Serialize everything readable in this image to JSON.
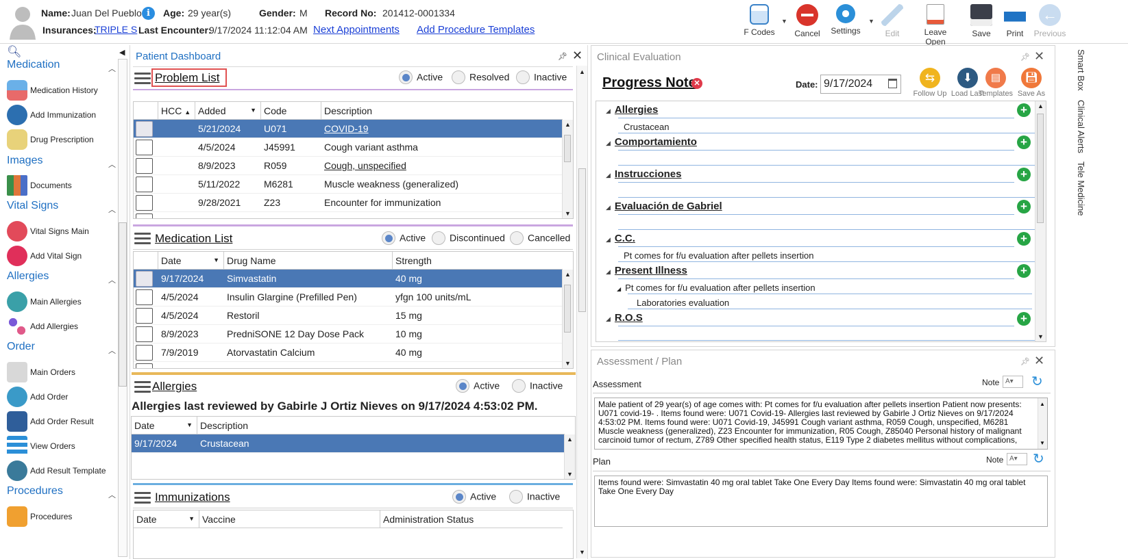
{
  "header": {
    "name_label": "Name:",
    "name_value": "Juan Del Pueblo",
    "age_label": "Age:",
    "age_value": "29 year(s)",
    "gender_label": "Gender:",
    "gender_value": "M",
    "record_label": "Record No:",
    "record_value": "201412-0001334",
    "insurances_label": "Insurances:",
    "insurance_link": "TRIPLE S",
    "last_encounter_label": "Last Encounter:",
    "last_encounter_value": "9/17/2024 11:12:04 AM",
    "next_appointments": "Next Appointments",
    "add_procedure_templates": "Add Procedure Templates"
  },
  "toolbar": {
    "fcodes": "F Codes",
    "cancel": "Cancel",
    "settings": "Settings",
    "edit": "Edit",
    "leave_open": "Leave Open",
    "save": "Save",
    "print": "Print",
    "previous": "Previous"
  },
  "sidebar": {
    "medication": "Medication",
    "medication_history": "Medication History",
    "add_immunization": "Add Immunization",
    "drug_prescription": "Drug Prescription",
    "images": "Images",
    "documents": "Documents",
    "vital_signs": "Vital Signs",
    "vital_signs_main": "Vital Signs Main",
    "add_vital_sign": "Add Vital Sign",
    "allergies": "Allergies",
    "main_allergies": "Main Allergies",
    "add_allergies": "Add Allergies",
    "order": "Order",
    "main_orders": "Main Orders",
    "add_order": "Add Order",
    "add_order_result": "Add Order Result",
    "view_orders": "View Orders",
    "add_result_template": "Add Result Template",
    "procedures": "Procedures",
    "procedures_item": "Procedures"
  },
  "dashboard": {
    "title": "Patient Dashboard",
    "problem_list": {
      "title": "Problem List",
      "filters": [
        "Active",
        "Resolved",
        "Inactive"
      ],
      "headers": [
        "HCC",
        "Added",
        "Code",
        "Description"
      ],
      "rows": [
        {
          "added": "5/21/2024",
          "code": "U071",
          "desc": "COVID-19"
        },
        {
          "added": "4/5/2024",
          "code": "J45991",
          "desc": "Cough variant asthma"
        },
        {
          "added": "8/9/2023",
          "code": "R059",
          "desc": "Cough, unspecified"
        },
        {
          "added": "5/11/2022",
          "code": "M6281",
          "desc": "Muscle weakness (generalized)"
        },
        {
          "added": "9/28/2021",
          "code": "Z23",
          "desc": "Encounter for immunization"
        }
      ]
    },
    "medication_list": {
      "title": "Medication List",
      "filters": [
        "Active",
        "Discontinued",
        "Cancelled"
      ],
      "headers": [
        "Date",
        "Drug Name",
        "Strength"
      ],
      "rows": [
        {
          "date": "9/17/2024",
          "drug": "Simvastatin",
          "strength": "40 mg"
        },
        {
          "date": "4/5/2024",
          "drug": "Insulin Glargine (Prefilled Pen)",
          "strength": "yfgn 100 units/mL"
        },
        {
          "date": "4/5/2024",
          "drug": "Restoril",
          "strength": "15 mg"
        },
        {
          "date": "8/9/2023",
          "drug": "PredniSONE 12 Day Dose Pack",
          "strength": "10 mg"
        },
        {
          "date": "7/9/2019",
          "drug": "Atorvastatin Calcium",
          "strength": "40 mg"
        }
      ]
    },
    "allergies": {
      "title": "Allergies",
      "filters": [
        "Active",
        "Inactive"
      ],
      "reviewed": "Allergies last reviewed by Gabirle J Ortiz Nieves on 9/17/2024 4:53:02 PM.",
      "headers": [
        "Date",
        "Description"
      ],
      "rows": [
        {
          "date": "9/17/2024",
          "desc": "Crustacean"
        }
      ]
    },
    "immunizations": {
      "title": "Immunizations",
      "filters": [
        "Active",
        "Inactive"
      ],
      "headers": [
        "Date",
        "Vaccine",
        "Administration Status"
      ]
    }
  },
  "clinical": {
    "title": "Clinical Evaluation",
    "note_title": "Progress Note",
    "date_label": "Date:",
    "date_value": "9/17/2024",
    "actions": [
      "Follow Up",
      "Load Last",
      "Templates",
      "Save As"
    ],
    "sections": {
      "allergies": "Allergies",
      "allergies_text": "Crustacean",
      "comportamiento": "Comportamiento",
      "instrucciones": "Instrucciones",
      "evaluacion": "Evaluación de Gabriel",
      "cc": "C.C.",
      "cc_text": "Pt comes for f/u evaluation after pellets insertion",
      "present_illness": "Present Illness",
      "pi_sub": "Pt comes for f/u evaluation after pellets insertion",
      "pi_sub2": "Laboratories evaluation",
      "ros": "R.O.S"
    }
  },
  "assessment": {
    "title": "Assessment / Plan",
    "assessment_label": "Assessment",
    "note_label": "Note",
    "assessment_lines": [
      "Male patient of 29 year(s) of age comes with:  Pt comes for f/u evaluation after pellets insertion  Patient now presents:",
      "U071 covid-19- . Items found were:  U071 Covid-19-    Allergies last reviewed by Gabirle J Ortiz Nieves on 9/17/2024",
      "4:53:02 PM.     Items found were:  U071 Covid-19, J45991 Cough variant asthma, R059 Cough, unspecified, M6281",
      "Muscle weakness (generalized), Z23 Encounter for immunization, R05 Cough, Z85040 Personal history of malignant",
      "carcinoid tumor of rectum, Z789 Other specified health status, E119 Type 2 diabetes mellitus without complications,"
    ],
    "plan_label": "Plan",
    "plan_text": "  Items found were:  Simvastatin 40 mg oral tablet Take One Every Day   Items found were:  Simvastatin 40 mg oral tablet Take One Every Day"
  },
  "right_tabs": [
    "Smart Box",
    "Clinical Alerts",
    "Tele Medicine"
  ],
  "colors": {
    "accent": "#1e6fc2",
    "selection": "#4a78b5",
    "problem_divider": "#c9a6e0",
    "allergy_divider": "#e8b85a",
    "immun_divider": "#6aaee0",
    "plus": "#27a545",
    "highlight_box": "#e05050"
  }
}
